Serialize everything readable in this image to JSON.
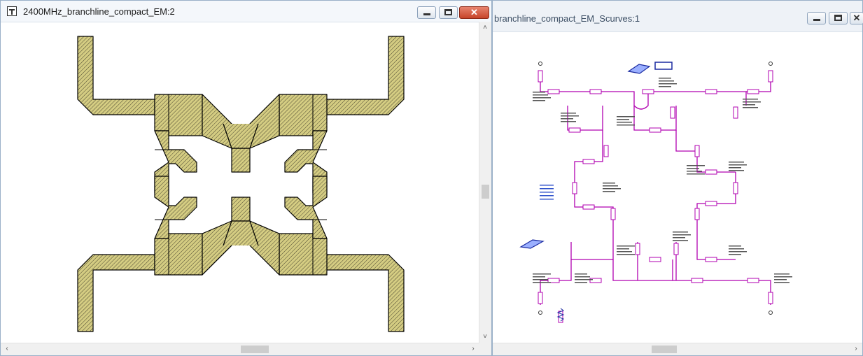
{
  "windows": [
    {
      "title": "2400MHz_branchline_compact_EM:2",
      "view": "layout",
      "controls": {
        "minimize_icon": "minimize-icon",
        "maximize_icon": "maximize-icon",
        "close_icon": "close-icon",
        "close_glyph": "✕"
      }
    },
    {
      "title": "branchline_compact_EM_Scurves:1",
      "view": "schematic",
      "controls": {
        "minimize_icon": "minimize-icon",
        "maximize_icon": "maximize-icon",
        "close_icon": "close-icon",
        "close_glyph": "✕"
      }
    }
  ],
  "scroll_arrows": {
    "up": "˄",
    "down": "˅",
    "left": "‹",
    "right": "›"
  },
  "colors": {
    "metal_fill": "#d4cc82",
    "metal_outline": "#000000",
    "schematic_wire": "#b000b0",
    "schematic_text": "#1a1a1a",
    "annotation_blue": "#3355cc",
    "close_button": "#c64429"
  }
}
